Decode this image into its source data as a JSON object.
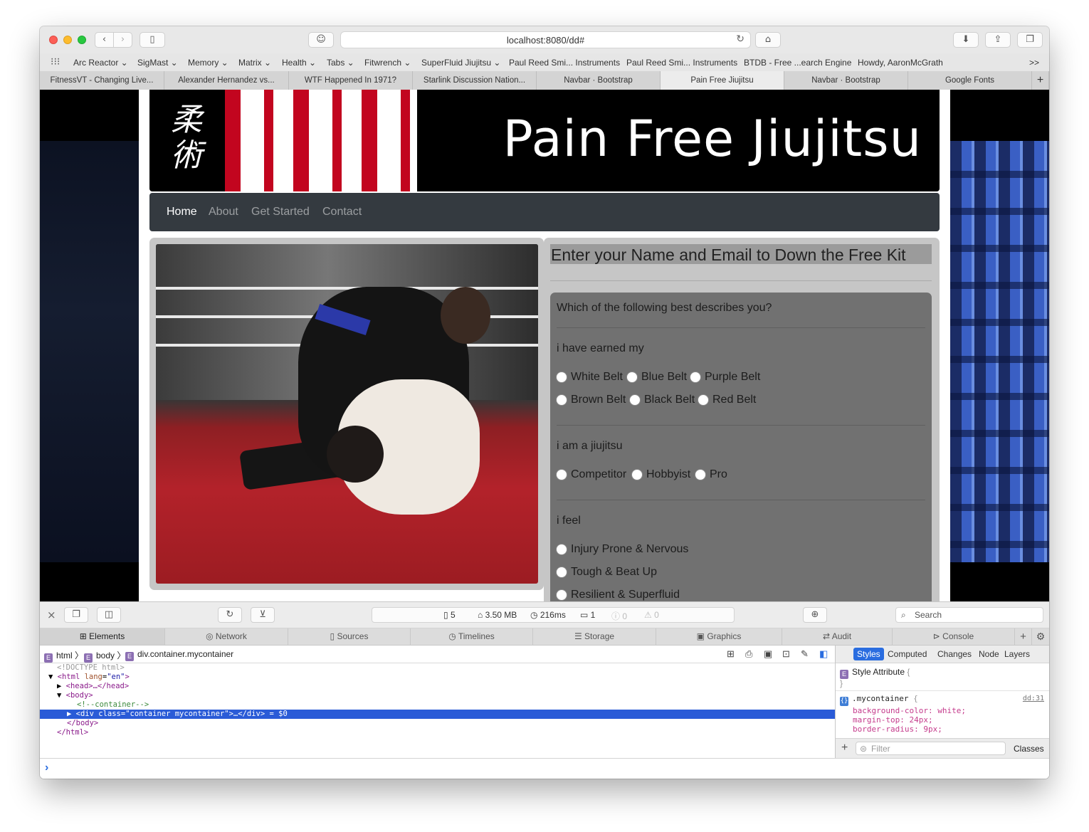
{
  "browser": {
    "url": "localhost:8080/dd#",
    "bookmarks": [
      "Arc Reactor ⌄",
      "SigMast ⌄",
      "Memory ⌄",
      "Matrix ⌄",
      "Health ⌄",
      "Tabs ⌄",
      "Fitwrench ⌄",
      "SuperFluid Jiujitsu ⌄",
      "Paul Reed Smi... Instruments",
      "Paul Reed Smi... Instruments",
      "BTDB - Free ...earch Engine",
      "Howdy, AaronMcGrath"
    ],
    "bookmarks_more": ">>",
    "tabs": [
      "FitnessVT - Changing Live...",
      "Alexander Hernandez vs...",
      "WTF Happened In 1971?",
      "Starlink Discussion Nation...",
      "Navbar · Bootstrap",
      "Pain Free Jiujitsu",
      "Navbar · Bootstrap",
      "Google Fonts"
    ],
    "active_tab_index": 5,
    "new_tab": "+"
  },
  "page": {
    "kanji": "柔術",
    "title": "Pain Free Jiujitsu",
    "nav": [
      "Home",
      "About",
      "Get Started",
      "Contact"
    ],
    "form_heading": "Enter your Name and Email to Down the Free Kit",
    "question": "Which of the following best describes you?",
    "q1_label": "i have earned my",
    "q1_options": [
      "White Belt",
      "Blue Belt",
      "Purple Belt",
      "Brown Belt",
      "Black Belt",
      "Red Belt"
    ],
    "q2_label": "i am a jiujitsu",
    "q2_options": [
      "Competitor",
      "Hobbyist",
      "Pro"
    ],
    "q3_label": "i feel",
    "q3_options": [
      "Injury Prone & Nervous",
      "Tough & Beat Up",
      "Resilient & Superfluid"
    ]
  },
  "devtools": {
    "status": {
      "resources": "5",
      "size": "3.50 MB",
      "time": "216ms",
      "logs": "1",
      "errors": "0",
      "warnings": "0"
    },
    "search_placeholder": "Search",
    "tabs": [
      "Elements",
      "Network",
      "Sources",
      "Timelines",
      "Storage",
      "Graphics",
      "Audit",
      "Console"
    ],
    "active_tab": "Elements",
    "breadcrumb": [
      "html",
      "body",
      "div.container.mycontainer"
    ],
    "dom": {
      "doctype": "<!DOCTYPE html>",
      "html_open_tag": "<html",
      "lang_attr": "lang",
      "lang_value": "\"en\"",
      "head": "<head>…</head>",
      "body_open": "<body>",
      "comment": "<!--container-->",
      "selected_line": "<div class=\"container mycontainer\">…</div> = $0",
      "body_close": "</body>",
      "html_close": "</html>"
    },
    "sidebar_tabs": [
      "Styles",
      "Computed",
      "Changes",
      "Node",
      "Layers"
    ],
    "style_attribute": "Style Attribute",
    "rule_selector": ".mycontainer",
    "rule_source": "dd:31",
    "rule_props": [
      "background-color: white;",
      "margin-top: 24px;",
      "border-radius: 9px;"
    ],
    "filter_placeholder": "Filter",
    "classes_label": "Classes",
    "console_prompt": "›"
  }
}
